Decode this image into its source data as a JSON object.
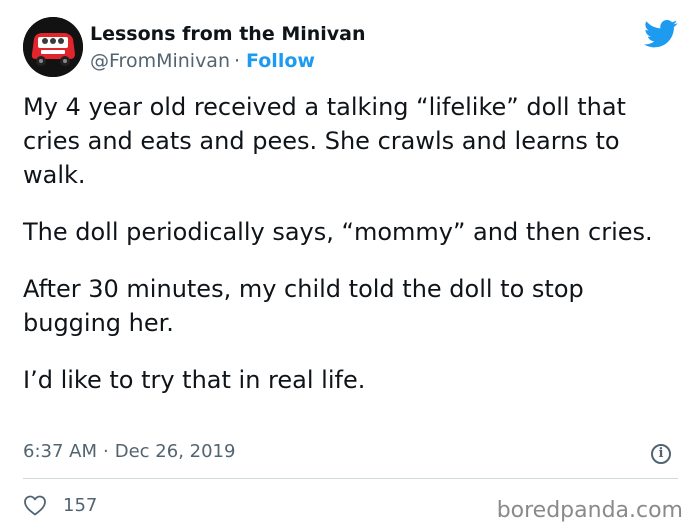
{
  "author": {
    "name": "Lessons from the Minivan",
    "handle": "@FromMinivan",
    "separator": "·",
    "follow_label": "Follow"
  },
  "tweet": {
    "paragraphs": [
      "My 4 year old received a talking “lifelike” doll that cries and eats and pees. She crawls and learns to walk.",
      "The doll periodically says, “mommy” and then cries.",
      "After 30 minutes, my child told the doll to stop bugging her.",
      "I’d like to try that in real life."
    ],
    "time": "6:37 AM",
    "date_separator": "·",
    "date": "Dec 26, 2019"
  },
  "stats": {
    "likes": "157"
  },
  "icons": {
    "brand": "twitter-bird-icon",
    "info": "info-icon",
    "like": "heart-icon",
    "info_glyph": "i"
  },
  "watermark": "boredpanda.com",
  "colors": {
    "accent": "#1d9bf0",
    "text": "#0f1419",
    "muted": "#536471",
    "avatar_car": "#e0262c"
  }
}
